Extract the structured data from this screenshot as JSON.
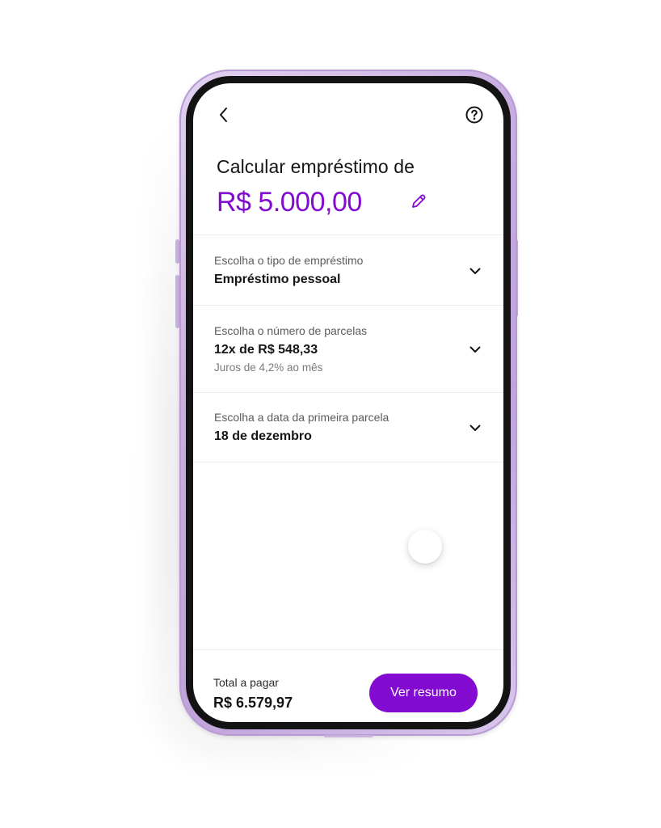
{
  "header": {
    "back_icon": "chevron-left-icon",
    "help_icon": "question-circle-icon"
  },
  "calculator": {
    "title": "Calcular empréstimo de",
    "amount": "R$ 5.000,00",
    "edit_icon": "pencil-icon",
    "accent_color": "#820ad1"
  },
  "options": [
    {
      "label": "Escolha o tipo de empréstimo",
      "value": "Empréstimo pessoal",
      "sub": ""
    },
    {
      "label": "Escolha o número de parcelas",
      "value": "12x de R$ 548,33",
      "sub": "Juros de 4,2% ao mês"
    },
    {
      "label": "Escolha a data da primeira parcela",
      "value": "18 de dezembro",
      "sub": ""
    }
  ],
  "footer": {
    "total_label": "Total a pagar",
    "total_value": "R$ 6.579,97",
    "cta_label": "Ver resumo"
  }
}
